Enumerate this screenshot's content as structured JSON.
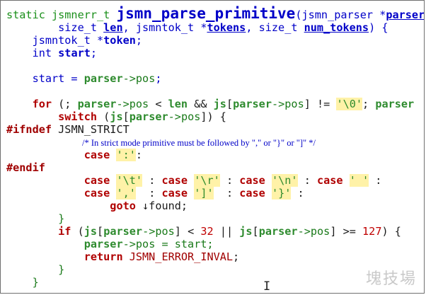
{
  "code": {
    "l1_type": "static jsmnerr_t",
    "l1_fn": "jsmn_parse_primitive",
    "l1_open": "(jsmn_parser *",
    "l1_param": "parser",
    "l1_tail": ",",
    "l2_a": "        size_t ",
    "l2_len": "len",
    "l2_b": ", jsmntok_t *",
    "l2_tokens": "tokens",
    "l2_c": ", size_t ",
    "l2_num": "num_tokens",
    "l2_d": ") {",
    "l3": "    jsmntok_t *",
    "l3_id": "token",
    "l3_end": ";",
    "l4": "    int ",
    "l4_id": "start",
    "l4_end": ";",
    "l6_a": "    start = ",
    "l6_p": "parser",
    "l6_b": "->",
    "l6_pos": "pos",
    "l6_end": ";",
    "l8_for": "    for",
    "l8_a": " (; ",
    "l8_p": "parser",
    "l8_b": "->",
    "l8_pos": "pos",
    "l8_c": " < ",
    "l8_len": "len",
    "l8_d": " && ",
    "l8_js": "js",
    "l8_e": "[",
    "l8_p2": "parser",
    "l8_f": "->",
    "l8_pos2": "pos",
    "l8_g": "] != ",
    "l8_str": "'\\0'",
    "l8_h": "; ",
    "l8_p3": "parser",
    "l9_sw": "        switch",
    "l9_a": " (",
    "l9_js": "js",
    "l9_b": "[",
    "l9_p": "parser",
    "l9_c": "->",
    "l9_pos": "pos",
    "l9_d": "]) {",
    "l10_pp": "#ifndef",
    "l10_macro": " JSMN_STRICT",
    "l11_comment": "/* In strict mode primitive must be followed by \",\" or \"}\" or \"]\" */",
    "l12_case": "            case",
    "l12_str": "':'",
    "l12_end": ":",
    "l13_pp": "#endif",
    "l14_case1": "            case",
    "l14_s1": "'\\t'",
    "l14_sep1": " : ",
    "l14_case2": "case",
    "l14_s2": "'\\r'",
    "l14_sep2": " : ",
    "l14_case3": "case",
    "l14_s3": "'\\n'",
    "l14_sep3": " : ",
    "l14_case4": "case",
    "l14_s4": "' '",
    "l14_end": " :",
    "l15_case1": "            case",
    "l15_s1": "','",
    "l15_sep1": "  : ",
    "l15_case2": "case",
    "l15_s2": "']'",
    "l15_sep2": "  : ",
    "l15_case3": "case",
    "l15_s3": "'}'",
    "l15_end": " :",
    "l16_goto": "                goto",
    "l16_arrow": " ↓",
    "l16_label": "found;",
    "l17": "        }",
    "l18_if": "        if",
    "l18_a": " (",
    "l18_js": "js",
    "l18_b": "[",
    "l18_p": "parser",
    "l18_c": "->",
    "l18_pos": "pos",
    "l18_d": "] < ",
    "l18_n1": "32",
    "l18_e": " || ",
    "l18_js2": "js",
    "l18_f": "[",
    "l18_p2": "parser",
    "l18_g": "->",
    "l18_pos2": "pos",
    "l18_h": "] >= ",
    "l18_n2": "127",
    "l18_i": ") {",
    "l19_a": "            ",
    "l19_p": "parser",
    "l19_b": "->",
    "l19_pos": "pos",
    "l19_c": " = start;",
    "l20_ret": "            return",
    "l20_macro": " JSMN_ERROR_INVAL",
    "l20_end": ";",
    "l21": "        }",
    "l22": "    }"
  },
  "watermark": "塊技場",
  "cursor_glyph": "I"
}
